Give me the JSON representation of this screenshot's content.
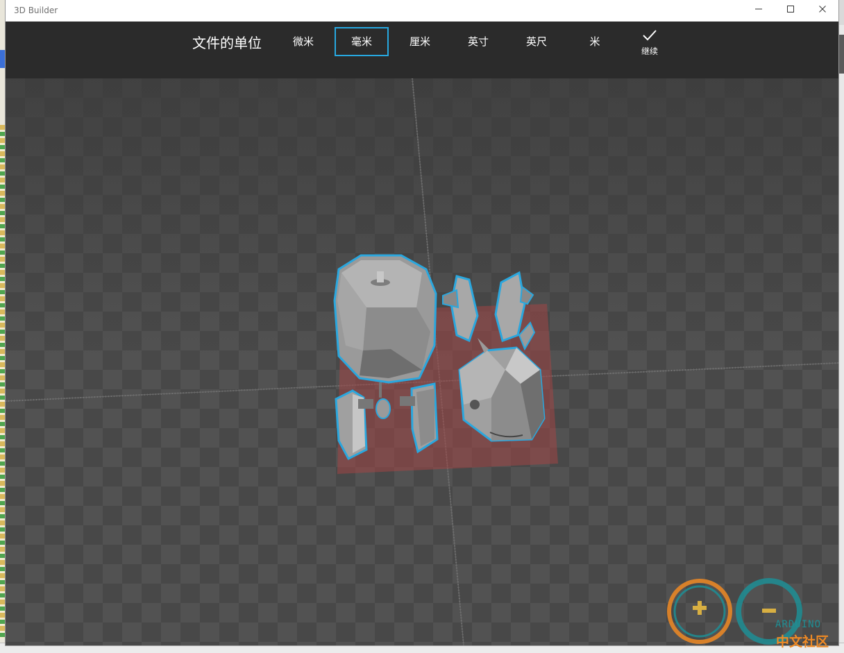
{
  "window": {
    "title": "3D Builder"
  },
  "toolbar": {
    "heading": "文件的单位",
    "units": [
      {
        "label": "微米",
        "selected": false
      },
      {
        "label": "毫米",
        "selected": true
      },
      {
        "label": "厘米",
        "selected": false
      },
      {
        "label": "英寸",
        "selected": false
      },
      {
        "label": "英尺",
        "selected": false
      },
      {
        "label": "米",
        "selected": false
      }
    ],
    "continue_label": "继续"
  },
  "watermark": {
    "brand": "ARDUINO",
    "text": "中文社区"
  },
  "colors": {
    "accent": "#27a9e1",
    "toolbar_bg": "#2b2b2b",
    "viewport_bg": "#444444",
    "selection_outline": "#2aa7de",
    "plate_red": "#a04545",
    "wm_orange": "#f08a24",
    "wm_teal": "#1e8f95"
  }
}
